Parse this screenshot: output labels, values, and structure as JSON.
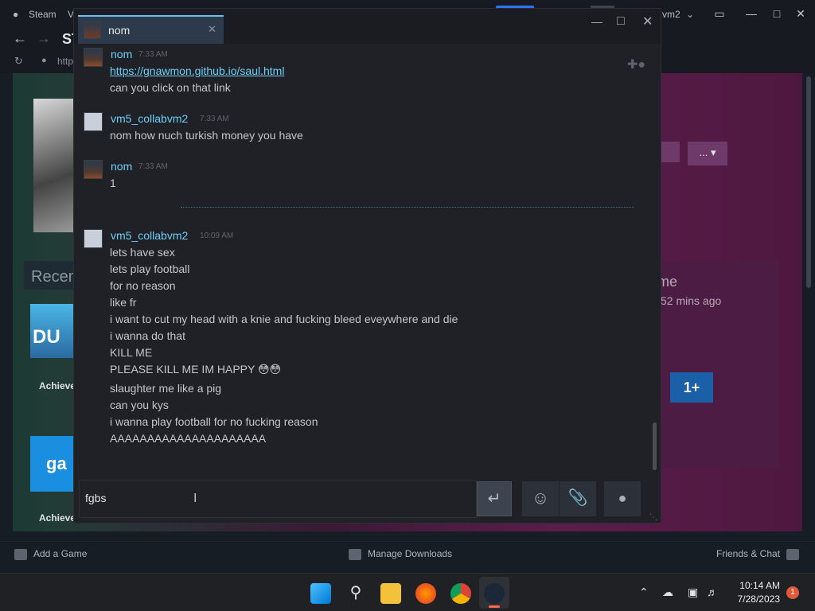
{
  "steam": {
    "menu_steam": "Steam",
    "menu_view": "V",
    "user_menu": "vm2",
    "nav_title": "ST",
    "url_text": "http",
    "recent_label": "Recen",
    "achievement_label_1": "Achieve",
    "achievement_label_2": "Achieve",
    "side_name": "me",
    "side_time": "52 mins ago",
    "more_button": "...",
    "bottom_add_game": "Add a Game",
    "bottom_manage_downloads": "Manage Downloads",
    "bottom_friends_chat": "Friends & Chat"
  },
  "chat": {
    "tab_name": "nom",
    "input_value": "fgbs",
    "messages": [
      {
        "sender": "nom",
        "time": "7:33 AM",
        "lines": [
          "https://gnawmon.github.io/saul.html",
          "can you click on that link"
        ]
      },
      {
        "sender": "vm5_collabvm2",
        "time": "7:33 AM",
        "lines": [
          "nom how nuch turkish money you have"
        ]
      },
      {
        "sender": "nom",
        "time": "7:33 AM",
        "lines": [
          "1"
        ]
      },
      {
        "sender": "vm5_collabvm2",
        "time": "10:09 AM",
        "lines": [
          "lets have sex",
          "lets play football",
          "for no reason",
          "like fr",
          "i want to cut my head with a knie and fucking bleed eveywhere and die",
          "i wanna do that",
          "KILL ME",
          "PLEASE KILL ME IM HAPPY 😳😳",
          "slaughter me like a pig",
          "can you kys",
          "i wanna play football for no fucking reason",
          "AAAAAAAAAAAAAAAAAAAAA"
        ]
      }
    ]
  },
  "taskbar": {
    "time": "10:14 AM",
    "date": "7/28/2023",
    "notifications": "1"
  },
  "colors": {
    "accent": "#67c1f5",
    "sender": "#6dcff6"
  }
}
